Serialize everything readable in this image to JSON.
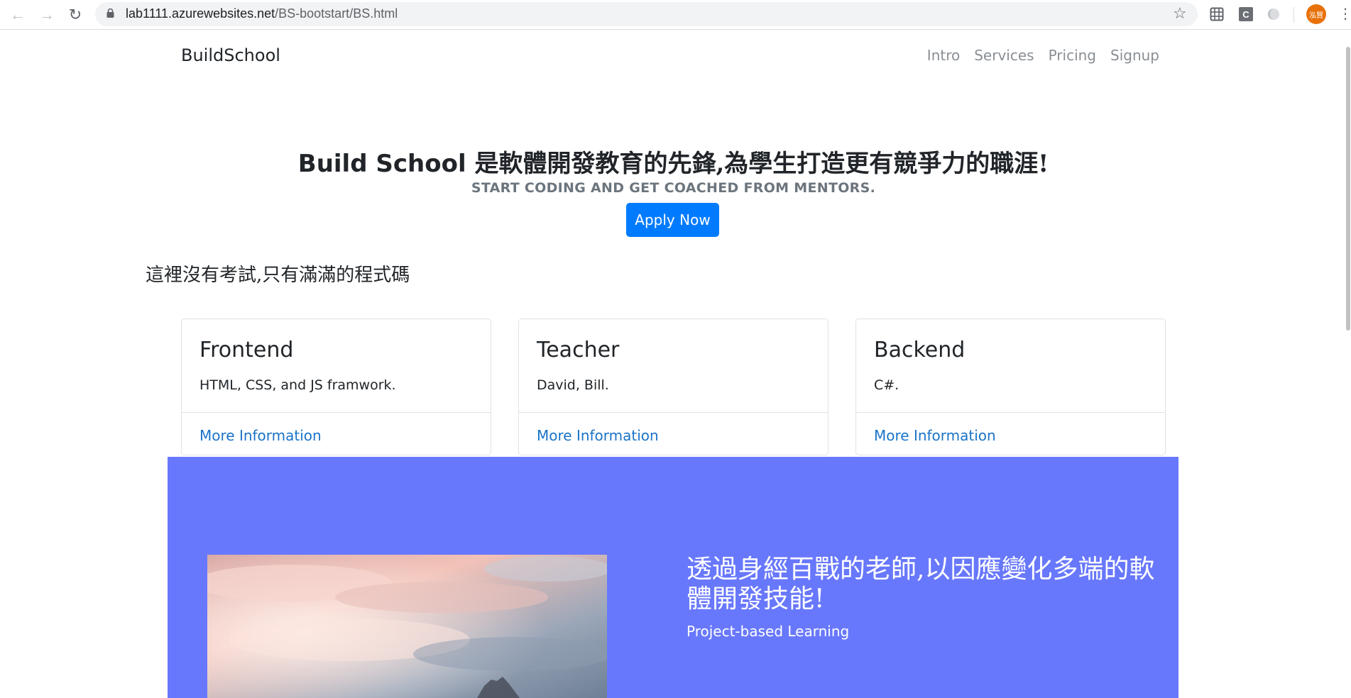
{
  "browser": {
    "url_host": "lab1111.azurewebsites.net",
    "url_path": "/BS-bootstart/BS.html",
    "profile_label": "泓賢",
    "extension_c_label": "C"
  },
  "navbar": {
    "brand": "BuildSchool",
    "links": [
      "Intro",
      "Services",
      "Pricing",
      "Signup"
    ]
  },
  "hero": {
    "title_bold": "Build School",
    "title_rest": " 是軟體開發教育的先鋒,為學生打造更有競爭力的職涯!",
    "subtitle": "START CODING AND GET COACHED FROM MENTORS.",
    "button": "Apply Now"
  },
  "section": {
    "heading": "這裡沒有考試,只有滿滿的程式碼"
  },
  "cards": [
    {
      "title": "Frontend",
      "text": "HTML, CSS, and JS framwork.",
      "link": "More Information"
    },
    {
      "title": "Teacher",
      "text": "David, Bill.",
      "link": "More Information"
    },
    {
      "title": "Backend",
      "text": "C#.",
      "link": "More Information"
    }
  ],
  "feature": {
    "heading": "透過身經百戰的老師,以因應變化多端的軟體開發技能!",
    "subtitle": "Project-based Learning",
    "background_color": "#6878fc"
  },
  "colors": {
    "primary": "#007bff",
    "link": "#1a73c8",
    "muted": "#6c757d"
  }
}
